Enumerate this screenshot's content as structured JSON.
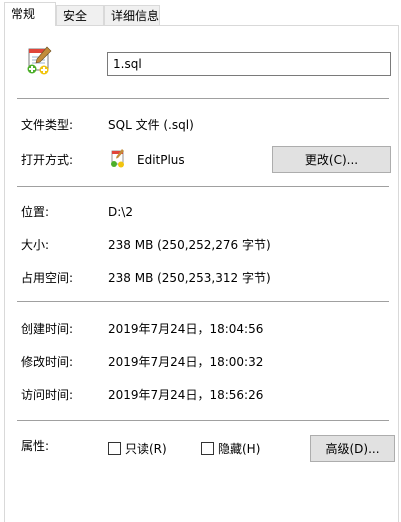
{
  "tabs": [
    {
      "label": "常规",
      "active": true
    },
    {
      "label": "安全",
      "active": false
    },
    {
      "label": "详细信息",
      "active": false
    }
  ],
  "file": {
    "name": "1.sql",
    "icon": "notepad-plus-icon"
  },
  "type_row": {
    "label": "文件类型:",
    "value": "SQL 文件 (.sql)"
  },
  "opens_with_row": {
    "label": "打开方式:",
    "app_name": "EditPlus",
    "app_icon": "editplus-icon",
    "change_button": "更改(C)..."
  },
  "location_row": {
    "label": "位置:",
    "value": "D:\\2"
  },
  "size_row": {
    "label": "大小:",
    "value": "238 MB (250,252,276 字节)"
  },
  "size_on_disk_row": {
    "label": "占用空间:",
    "value": "238 MB (250,253,312 字节)"
  },
  "created_row": {
    "label": "创建时间:",
    "value": "2019年7月24日，18:04:56"
  },
  "modified_row": {
    "label": "修改时间:",
    "value": "2019年7月24日，18:00:32"
  },
  "accessed_row": {
    "label": "访问时间:",
    "value": "2019年7月24日，18:56:26"
  },
  "attributes_row": {
    "label": "属性:",
    "readonly_label": "只读(R)",
    "readonly_checked": false,
    "hidden_label": "隐藏(H)",
    "hidden_checked": false,
    "advanced_button": "高级(D)..."
  },
  "colors": {
    "separator": "#a0a0a0",
    "button_bg": "#e1e1e1",
    "tab_border": "#d9d9d9"
  }
}
